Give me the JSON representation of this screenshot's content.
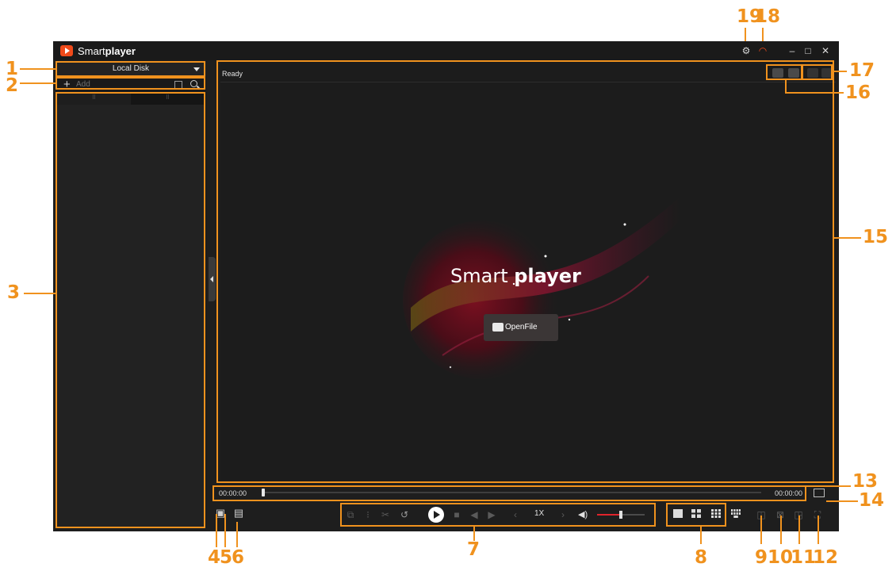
{
  "callouts": [
    "1",
    "2",
    "3",
    "4",
    "5",
    "6",
    "7",
    "8",
    "9",
    "10",
    "11",
    "12",
    "13",
    "14",
    "15",
    "16",
    "17",
    "18",
    "19"
  ],
  "app": {
    "title_light": "Smart",
    "title_bold": "player"
  },
  "window_controls": {
    "minimize": "–",
    "maximize": "□",
    "close": "✕"
  },
  "sidebar": {
    "disk_selector": "Local Disk",
    "add_label": "Add",
    "tabs": [
      "⠿",
      "⠿"
    ]
  },
  "video": {
    "status": "Ready",
    "brand_light": "Smart",
    "brand_bold": "player",
    "open_file_label": "OpenFile"
  },
  "progress": {
    "current_time": "00:00:00",
    "total_time": "00:00:00"
  },
  "playback": {
    "speed": "1X",
    "volume_level": 0.5
  },
  "colors": {
    "accent": "#f0921e",
    "brand": "#f04a1a",
    "volume": "#e0242b",
    "background": "#1e1e1e"
  }
}
